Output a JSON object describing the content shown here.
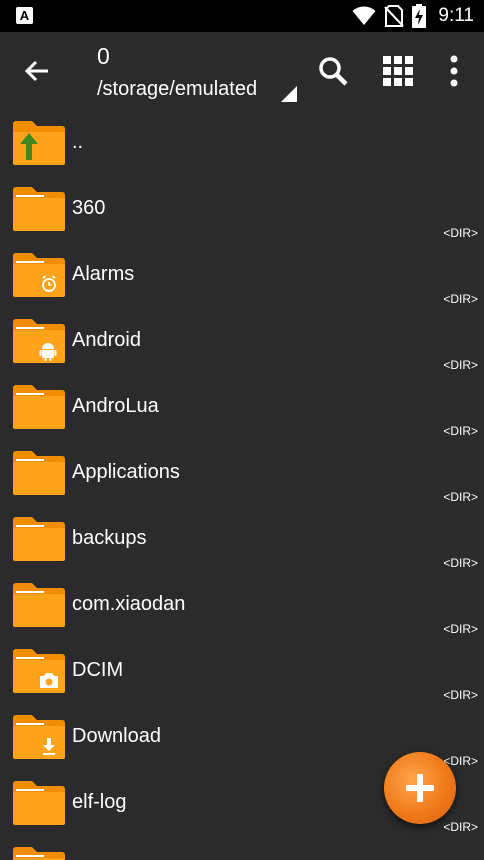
{
  "status_bar": {
    "app_badge": "A",
    "icons": [
      "wifi-icon",
      "no-sim-icon",
      "battery-charging-icon"
    ],
    "time": "9:11"
  },
  "toolbar": {
    "count": "0",
    "path": "/storage/emulated",
    "icons": [
      "back-arrow-icon",
      "path-dropdown-icon",
      "search-icon",
      "grid-view-icon",
      "more-vert-icon"
    ]
  },
  "files": [
    {
      "name": "..",
      "kind": "",
      "icon": "parent-folder-icon"
    },
    {
      "name": "360",
      "kind": "<DIR>",
      "icon": "folder-icon"
    },
    {
      "name": "Alarms",
      "kind": "<DIR>",
      "icon": "alarm-folder-icon"
    },
    {
      "name": "Android",
      "kind": "<DIR>",
      "icon": "android-folder-icon"
    },
    {
      "name": "AndroLua",
      "kind": "<DIR>",
      "icon": "folder-icon"
    },
    {
      "name": "Applications",
      "kind": "<DIR>",
      "icon": "folder-icon"
    },
    {
      "name": "backups",
      "kind": "<DIR>",
      "icon": "folder-icon"
    },
    {
      "name": "com.xiaodan",
      "kind": "<DIR>",
      "icon": "folder-icon"
    },
    {
      "name": "DCIM",
      "kind": "<DIR>",
      "icon": "camera-folder-icon"
    },
    {
      "name": "Download",
      "kind": "<DIR>",
      "icon": "download-folder-icon"
    },
    {
      "name": "elf-log",
      "kind": "<DIR>",
      "icon": "folder-icon"
    },
    {
      "name": "",
      "kind": "",
      "icon": "folder-icon"
    }
  ],
  "fab": {
    "icon": "add-icon"
  },
  "colors": {
    "background": "#2b2b2b",
    "status_bar": "#000000",
    "folder_body": "#ffa31a",
    "folder_tab": "#f08d00",
    "fab": "#f07a1a",
    "parent_arrow": "#3f8a1e"
  }
}
